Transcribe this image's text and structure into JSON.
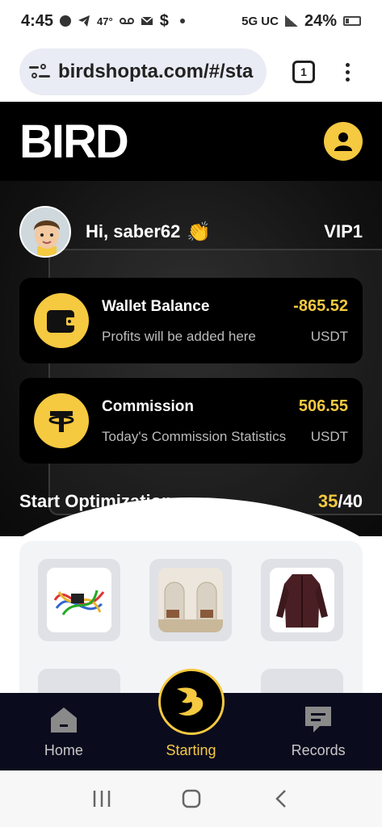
{
  "status_bar": {
    "time": "4:45",
    "temp": "47°",
    "dollar": "$",
    "network": "5G UC",
    "battery": "24%"
  },
  "browser": {
    "url": "birdshopta.com/#/sta",
    "tab_count": "1"
  },
  "app": {
    "logo_text": "BIRD"
  },
  "user": {
    "greeting": "Hi, saber62",
    "wave": "👏",
    "vip_level": "VIP1"
  },
  "wallet": {
    "title": "Wallet Balance",
    "value": "-865.52",
    "subtitle": "Profits will be added here",
    "unit": "USDT"
  },
  "commission": {
    "title": "Commission",
    "value": "506.55",
    "subtitle": "Today's Commission Statistics",
    "unit": "USDT"
  },
  "optimization": {
    "title": "Start Optimization",
    "done": "35",
    "separator": "/",
    "total": "40"
  },
  "bottom_nav": {
    "home": "Home",
    "starting": "Starting",
    "records": "Records"
  },
  "colors": {
    "accent": "#f5c940",
    "nav_bg": "#0b0b1e",
    "card_bg": "#000000"
  }
}
